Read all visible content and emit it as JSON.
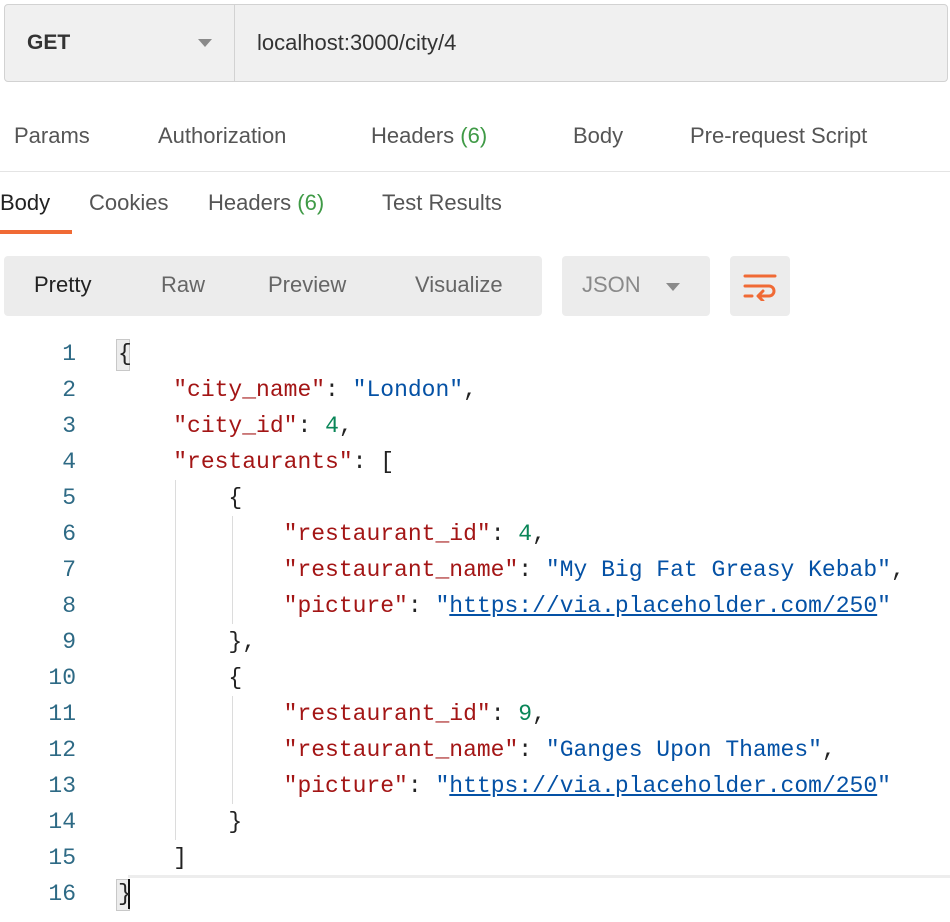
{
  "request": {
    "method": "GET",
    "url": "localhost:3000/city/4"
  },
  "request_tabs": {
    "params": "Params",
    "authorization": "Authorization",
    "headers_label": "Headers",
    "headers_count": "(6)",
    "body": "Body",
    "prerequest": "Pre-request Script"
  },
  "response_tabs": {
    "body": "Body",
    "cookies": "Cookies",
    "headers_label": "Headers",
    "headers_count": "(6)",
    "test_results": "Test Results"
  },
  "view_modes": {
    "pretty": "Pretty",
    "raw": "Raw",
    "preview": "Preview",
    "visualize": "Visualize",
    "format": "JSON"
  },
  "accent_color": "#f06a35",
  "code": {
    "line_numbers": [
      "1",
      "2",
      "3",
      "4",
      "5",
      "6",
      "7",
      "8",
      "9",
      "10",
      "11",
      "12",
      "13",
      "14",
      "15",
      "16"
    ],
    "l1": "{",
    "l2_key": "\"city_name\"",
    "l2_sep": ": ",
    "l2_val": "\"London\"",
    "l2_end": ",",
    "l3_key": "\"city_id\"",
    "l3_sep": ": ",
    "l3_val": "4",
    "l3_end": ",",
    "l4_key": "\"restaurants\"",
    "l4_end": ": [",
    "l5": "{",
    "l6_key": "\"restaurant_id\"",
    "l6_sep": ": ",
    "l6_val": "4",
    "l6_end": ",",
    "l7_key": "\"restaurant_name\"",
    "l7_sep": ": ",
    "l7_val": "\"My Big Fat Greasy Kebab\"",
    "l7_end": ",",
    "l8_key": "\"picture\"",
    "l8_sep": ": ",
    "l8_q1": "\"",
    "l8_url": "https://via.placeholder.com/250",
    "l8_q2": "\"",
    "l9": "},",
    "l10": "{",
    "l11_key": "\"restaurant_id\"",
    "l11_sep": ": ",
    "l11_val": "9",
    "l11_end": ",",
    "l12_key": "\"restaurant_name\"",
    "l12_sep": ": ",
    "l12_val": "\"Ganges Upon Thames\"",
    "l12_end": ",",
    "l13_key": "\"picture\"",
    "l13_sep": ": ",
    "l13_q1": "\"",
    "l13_url": "https://via.placeholder.com/250",
    "l13_q2": "\"",
    "l14": "}",
    "l15": "]",
    "l16": "}"
  }
}
